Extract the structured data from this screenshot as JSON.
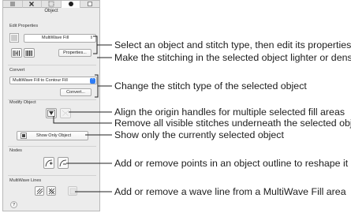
{
  "panel": {
    "title": "Object",
    "top_tabs": [
      {
        "icon": "list-icon"
      },
      {
        "icon": "tools-icon"
      },
      {
        "icon": "dotted-select-icon"
      },
      {
        "icon": "circle-icon"
      },
      {
        "icon": "square-icon"
      }
    ],
    "edit_properties": {
      "label": "Edit Properties",
      "stitch_type_value": "MultiWave Fill",
      "properties_button": "Properties..."
    },
    "convert": {
      "label": "Convert",
      "select_value": "MultiWave Fill to Contour Fill",
      "convert_button": "Convert..."
    },
    "modify_object": {
      "label": "Modify Object",
      "show_only_object_button": "Show Only Object"
    },
    "nodes": {
      "label": "Nodes"
    },
    "multiwave_lines": {
      "label": "MultiWave Lines"
    },
    "help_button": "?"
  },
  "annotations": [
    "Select an object and stitch type, then edit its properties",
    "Make the stitching in the selected object lighter or denser",
    "Change the stitch type of the selected object",
    "Align the origin handles for multiple selected fill areas",
    "Remove all visible stitches underneath the selected object",
    "Show only the currently selected object",
    "Add or remove points in an object outline to reshape it",
    "Add or remove a wave line from a MultiWave Fill area"
  ]
}
